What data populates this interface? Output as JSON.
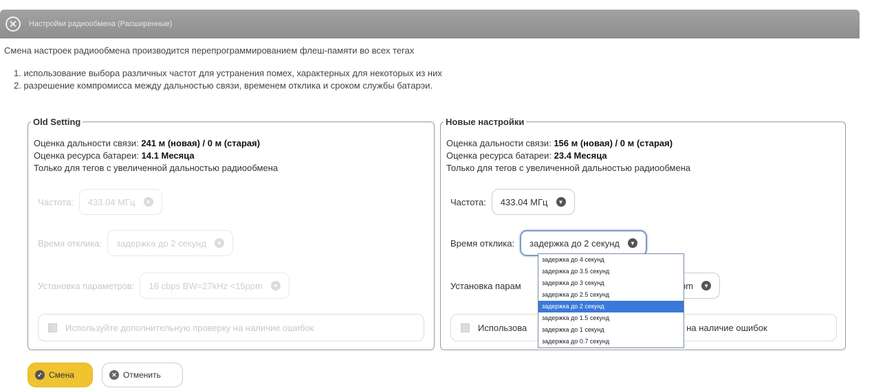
{
  "window": {
    "title": "Настройки радиообмена (Расширенные)"
  },
  "intro": "Смена настроек радиообмена производится перепрограммированием флеш-памяти во всех тегах",
  "reasons": [
    "1. использование выбора различных частот для устранения помех, характерных для некоторых из них",
    "2. разрешение компромисса между дальностью связи, временем отклика и сроком службы батарэи."
  ],
  "old": {
    "legend": "Old Setting",
    "range_label": "Оценка дальности связи:",
    "range_value": "241 м (новая) / 0 м (старая)",
    "battery_label": "Оценка ресурса батареи:",
    "battery_value": "14.1 Месяца",
    "note": "Только для тегов с увеличенной дальностью радиообмена",
    "freq_label": "Частота:",
    "freq_value": "433.04 МГц",
    "resp_label": "Время отклика:",
    "resp_value": "задержка до 2 секунд",
    "params_label": "Установка параметров:",
    "params_value": "16 cbps BW=27kHz <15ppm",
    "check_label": "Используйте дополнительную проверку на наличие ошибок"
  },
  "new": {
    "legend": "Новые настройки",
    "range_label": "Оценка дальности связи:",
    "range_value": "156 м (новая) / 0 м (старая)",
    "battery_label": "Оценка ресурса батареи:",
    "battery_value": "23.4 Месяца",
    "note": "Только для тегов с увеличенной дальностью радиообмена",
    "freq_label": "Частота:",
    "freq_value": "433.04 МГц",
    "resp_label": "Время отклика:",
    "resp_value": "задержка до 2 секунд",
    "params_label": "Установка парам",
    "params_value": "<23ppm",
    "check_label_a": "Использова",
    "check_label_b": "на наличие ошибок"
  },
  "dropdown": {
    "options": [
      "задержка до 4 секунд",
      "задержка до 3.5 секунд",
      "задержка до 3 секунд",
      "задержка до 2.5 секунд",
      "задержка до 2 секунд",
      "задержка до 1.5 секунд",
      "задержка до 1 секунд",
      "задержка до 0.7 секунд"
    ],
    "selected_index": 4
  },
  "buttons": {
    "ok": "Смена",
    "cancel": "Отменить"
  },
  "colors": {
    "accent": "#f0c330",
    "selection": "#3a79d8"
  }
}
